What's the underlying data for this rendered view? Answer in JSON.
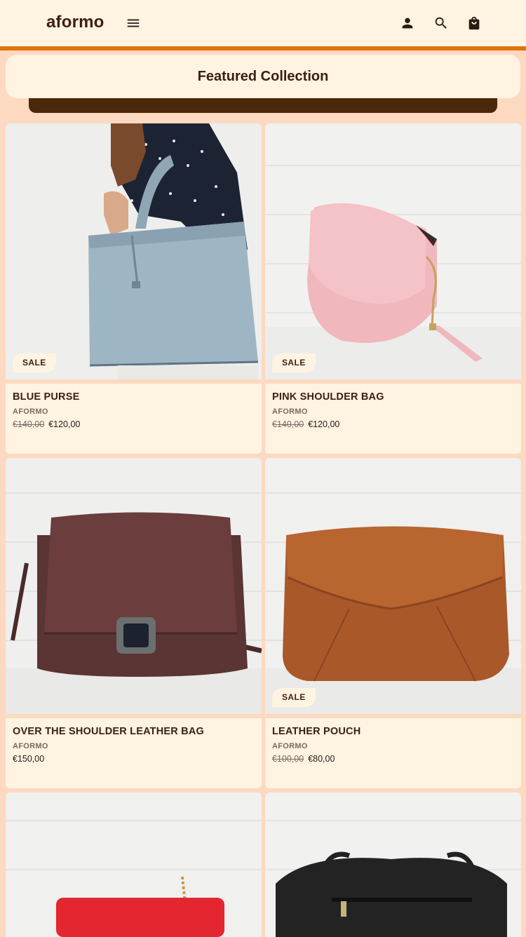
{
  "header": {
    "logo": "aformo",
    "icons": {
      "menu": "menu-icon",
      "account": "account-icon",
      "search": "search-icon",
      "cart": "shopping-bag-icon"
    }
  },
  "collection": {
    "title": "Featured Collection"
  },
  "products": [
    {
      "name": "BLUE PURSE",
      "vendor": "AFORMO",
      "old_price": "€140,00",
      "price": "€120,00",
      "badge": "SALE"
    },
    {
      "name": "PINK SHOULDER BAG",
      "vendor": "AFORMO",
      "old_price": "€140,00",
      "price": "€120,00",
      "badge": "SALE"
    },
    {
      "name": "OVER THE SHOULDER LEATHER BAG",
      "vendor": "AFORMO",
      "old_price": "",
      "price": "€150,00",
      "badge": ""
    },
    {
      "name": "LEATHER POUCH",
      "vendor": "AFORMO",
      "old_price": "€100,00",
      "price": "€80,00",
      "badge": "SALE"
    }
  ],
  "colors": {
    "background": "#fcd9c0",
    "surface": "#fff3e2",
    "accent": "#e0750a",
    "text": "#3b1f12"
  }
}
